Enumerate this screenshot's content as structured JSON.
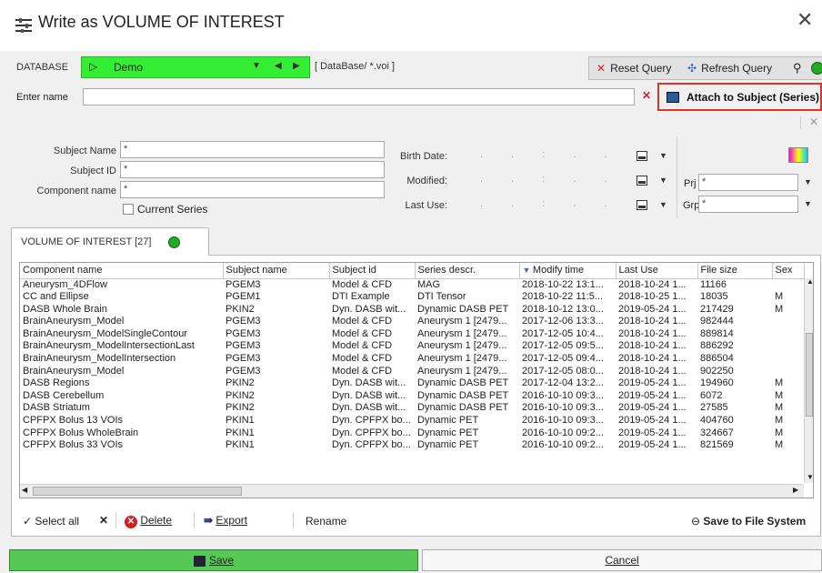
{
  "window": {
    "title": "Write as VOLUME OF INTEREST",
    "close": "✕"
  },
  "database": {
    "label": "DATABASE",
    "name": "Demo",
    "path": "[ DataBase/ *.voi ]"
  },
  "query": {
    "reset": "Reset Query",
    "refresh": "Refresh Query"
  },
  "name_field": {
    "label": "Enter name",
    "value": ""
  },
  "attach_button": "Attach to Subject (Series)",
  "filters": {
    "subject_name": {
      "label": "Subject Name",
      "value": "*"
    },
    "subject_id": {
      "label": "Subject ID",
      "value": "*"
    },
    "component_name": {
      "label": "Component name",
      "value": "*"
    },
    "current_series": "Current Series",
    "birth_date": "Birth Date:",
    "modified": "Modified:",
    "last_use": "Last Use:",
    "prj": {
      "label": "Prj",
      "value": "*"
    },
    "grp": {
      "label": "Grp",
      "value": "*"
    }
  },
  "tab": {
    "label": "VOLUME OF INTEREST [27]"
  },
  "table": {
    "columns": [
      "Component name",
      "Subject name",
      "Subject id",
      "Series descr.",
      "Modify time",
      "Last Use",
      "File size",
      "Sex"
    ],
    "rows": [
      [
        "Aneurysm_4DFlow",
        "PGEM3",
        "Model & CFD",
        "MAG",
        "2018-10-22 13:1...",
        "2018-10-24 1...",
        "11166",
        ""
      ],
      [
        "CC and Ellipse",
        "PGEM1",
        "DTI Example",
        "DTI Tensor",
        "2018-10-22 11:5...",
        "2018-10-25 1...",
        "18035",
        "M"
      ],
      [
        "DASB Whole Brain",
        "PKIN2",
        "Dyn. DASB wit...",
        "Dynamic DASB PET",
        "2018-10-12 13:0...",
        "2019-05-24 1...",
        "217429",
        "M"
      ],
      [
        "BrainAneurysm_Model",
        "PGEM3",
        "Model & CFD",
        "Aneurysm 1 [2479...",
        "2017-12-06 13:3...",
        "2018-10-24 1...",
        "982444",
        ""
      ],
      [
        "BrainAneurysm_ModelSingleContour",
        "PGEM3",
        "Model & CFD",
        "Aneurysm 1 [2479...",
        "2017-12-05 10:4...",
        "2018-10-24 1...",
        "889814",
        ""
      ],
      [
        "BrainAneurysm_ModelIntersectionLast",
        "PGEM3",
        "Model & CFD",
        "Aneurysm 1 [2479...",
        "2017-12-05 09:5...",
        "2018-10-24 1...",
        "886292",
        ""
      ],
      [
        "BrainAneurysm_ModelIntersection",
        "PGEM3",
        "Model & CFD",
        "Aneurysm 1 [2479...",
        "2017-12-05 09:4...",
        "2018-10-24 1...",
        "886504",
        ""
      ],
      [
        "BrainAneurysm_Model",
        "PGEM3",
        "Model & CFD",
        "Aneurysm 1 [2479...",
        "2017-12-05 08:0...",
        "2018-10-24 1...",
        "902250",
        ""
      ],
      [
        "DASB Regions",
        "PKIN2",
        "Dyn. DASB wit...",
        "Dynamic DASB PET",
        "2017-12-04 13:2...",
        "2019-05-24 1...",
        "194960",
        "M"
      ],
      [
        "DASB Cerebellum",
        "PKIN2",
        "Dyn. DASB wit...",
        "Dynamic DASB PET",
        "2016-10-10 09:3...",
        "2019-05-24 1...",
        "6072",
        "M"
      ],
      [
        "DASB Striatum",
        "PKIN2",
        "Dyn. DASB wit...",
        "Dynamic DASB PET",
        "2016-10-10 09:3...",
        "2019-05-24 1...",
        "27585",
        "M"
      ],
      [
        "CPFPX Bolus 13 VOIs",
        "PKIN1",
        "Dyn. CPFPX bo...",
        "Dynamic PET",
        "2016-10-10 09:3...",
        "2019-05-24 1...",
        "404760",
        "M"
      ],
      [
        "CPFPX Bolus WholeBrain",
        "PKIN1",
        "Dyn. CPFPX bo...",
        "Dynamic PET",
        "2016-10-10 09:2...",
        "2019-05-24 1...",
        "324667",
        "M"
      ],
      [
        "CPFPX Bolus 33 VOIs",
        "PKIN1",
        "Dyn. CPFPX bo...",
        "Dynamic PET",
        "2016-10-10 09:2...",
        "2019-05-24 1...",
        "821569",
        "M"
      ]
    ]
  },
  "actions": {
    "select_all": "Select all",
    "delete": "Delete",
    "export": "Export",
    "rename": "Rename",
    "save_fs": "Save to File System"
  },
  "footer": {
    "save": "Save",
    "cancel": "Cancel"
  }
}
